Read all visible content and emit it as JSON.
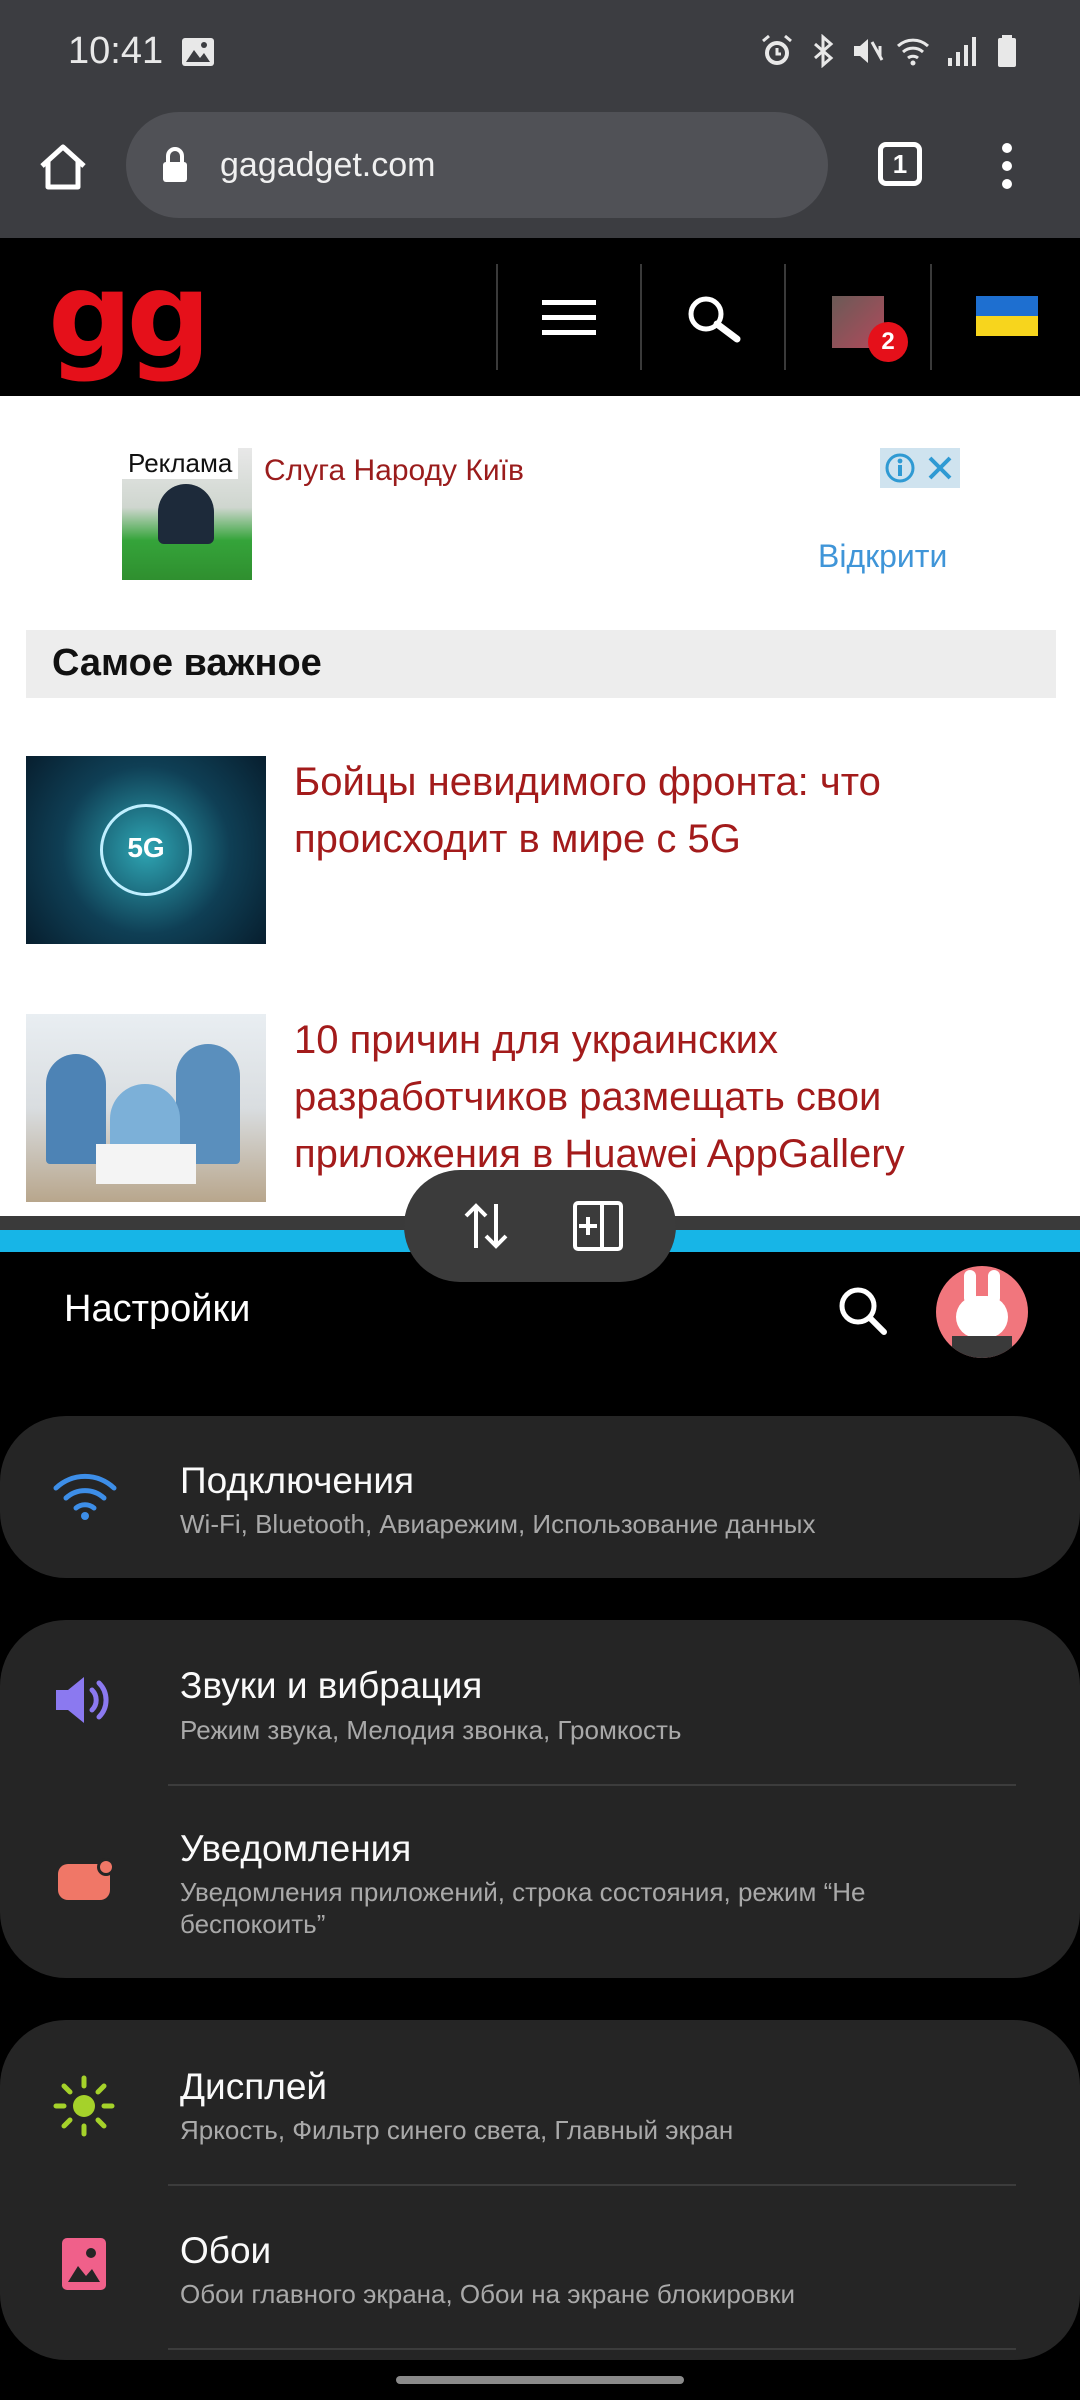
{
  "status_bar": {
    "time": "10:41"
  },
  "browser": {
    "url": "gagadget.com",
    "tab_count": "1"
  },
  "site": {
    "logo": "gg",
    "notification_count": "2"
  },
  "ad": {
    "label": "Реклама",
    "title": "Слуга Народу Київ",
    "open_label": "Відкрити"
  },
  "section": {
    "title": "Самое важное"
  },
  "articles": [
    {
      "title": "Бойцы невидимого фронта: что происходит в мире с 5G",
      "thumb_text": "5G"
    },
    {
      "title": "10 причин для украинских разработчиков размещать свои приложения в Huawei AppGallery"
    }
  ],
  "settings": {
    "title": "Настройки",
    "items": [
      {
        "title": "Подключения",
        "subtitle": "Wi-Fi, Bluetooth, Авиарежим, Использование данных"
      },
      {
        "title": "Звуки и вибрация",
        "subtitle": "Режим звука, Мелодия звонка, Громкость"
      },
      {
        "title": "Уведомления",
        "subtitle": "Уведомления приложений, строка состояния, режим “Не беспокоить”"
      },
      {
        "title": "Дисплей",
        "subtitle": "Яркость, Фильтр синего света, Главный экран"
      },
      {
        "title": "Обои",
        "subtitle": "Обои главного экрана, Обои на экране блокировки"
      }
    ]
  },
  "colors": {
    "accent_blue": "#17b5e7",
    "logo_red": "#e5101a",
    "headline_red": "#a31b1b",
    "wifi_icon": "#3d8ee8",
    "sound_icon": "#8b79f0",
    "notif_icon": "#f07767",
    "display_icon": "#a5d22a",
    "wallpaper_icon": "#f0608a"
  },
  "icons": {
    "status": [
      "image-icon",
      "alarm-icon",
      "bluetooth-icon",
      "mute-icon",
      "wifi-icon",
      "signal-icon",
      "battery-icon"
    ],
    "browser": [
      "home-icon",
      "lock-icon",
      "tabs-icon",
      "more-icon"
    ],
    "site": [
      "menu-icon",
      "search-icon",
      "avatar",
      "flag-ukraine-icon"
    ],
    "split": [
      "swap-icon",
      "add-window-icon"
    ]
  }
}
